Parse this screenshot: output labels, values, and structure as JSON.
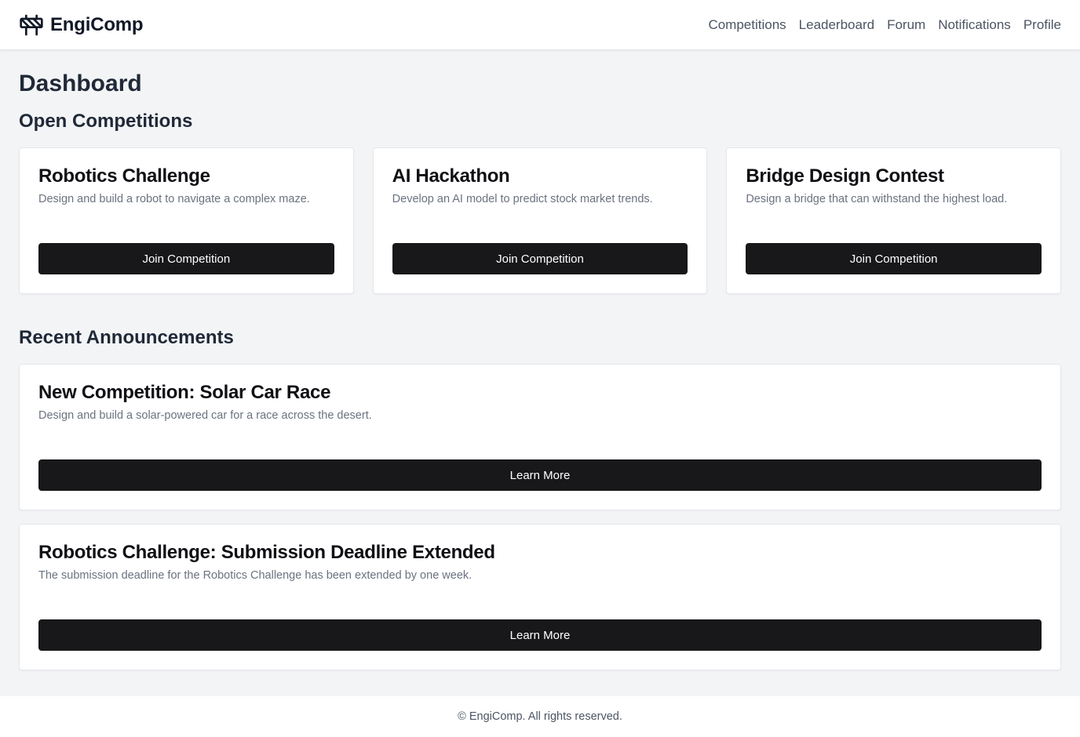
{
  "header": {
    "brand": "EngiComp",
    "logo_icon": "traffic-barrier-icon",
    "nav": [
      {
        "label": "Competitions"
      },
      {
        "label": "Leaderboard"
      },
      {
        "label": "Forum"
      },
      {
        "label": "Notifications"
      },
      {
        "label": "Profile"
      }
    ]
  },
  "main": {
    "title": "Dashboard",
    "competitions_heading": "Open Competitions",
    "competitions": [
      {
        "title": "Robotics Challenge",
        "description": "Design and build a robot to navigate a complex maze.",
        "button": "Join Competition"
      },
      {
        "title": "AI Hackathon",
        "description": "Develop an AI model to predict stock market trends.",
        "button": "Join Competition"
      },
      {
        "title": "Bridge Design Contest",
        "description": "Design a bridge that can withstand the highest load.",
        "button": "Join Competition"
      }
    ],
    "announcements_heading": "Recent Announcements",
    "announcements": [
      {
        "title": "New Competition: Solar Car Race",
        "description": "Design and build a solar-powered car for a race across the desert.",
        "button": "Learn More"
      },
      {
        "title": "Robotics Challenge: Submission Deadline Extended",
        "description": "The submission deadline for the Robotics Challenge has been extended by one week.",
        "button": "Learn More"
      }
    ]
  },
  "footer": {
    "text": "© EngiComp. All rights reserved."
  },
  "colors": {
    "background": "#f3f4f6",
    "button": "#18181b",
    "card": "#ffffff",
    "muted_text": "#6b7280"
  }
}
